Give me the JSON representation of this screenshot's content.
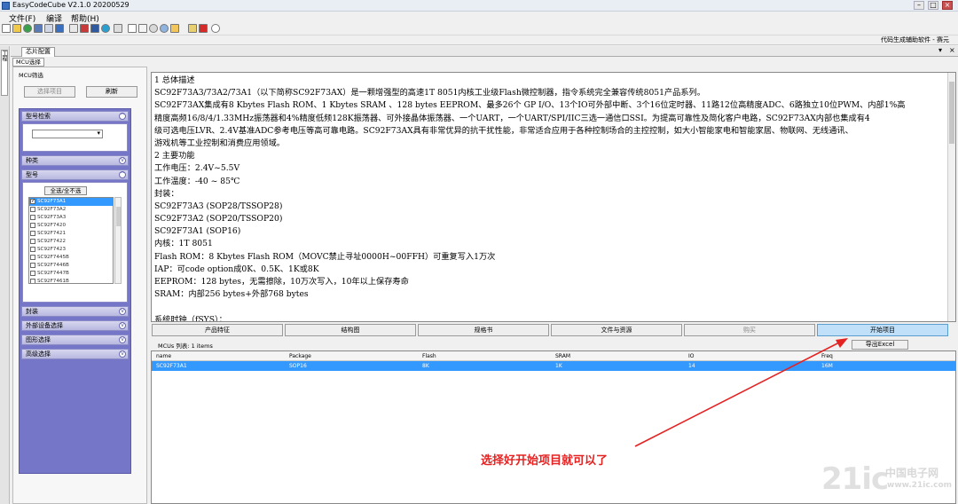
{
  "window": {
    "title": "EasyCodeCube V2.1.0 20200529"
  },
  "menu": [
    "文件(F)",
    "编译",
    "帮助(H)"
  ],
  "toolbar_icons": [
    "new-file-icon",
    "open-folder-icon",
    "refresh-icon",
    "save-icon",
    "bookmark-icon",
    "download-icon",
    "export-icon",
    "pdf-icon",
    "chip-icon",
    "globe-icon",
    "chip-small-icon",
    "print-icon",
    "search-icon",
    "gear-icon",
    "gear-alt-icon",
    "hand-icon",
    "dropdown-icon",
    "lock-icon",
    "logo-red-icon",
    "info-icon"
  ],
  "helper_bar": {
    "text": "代码生成辅助软件 - 赛元"
  },
  "side_rail": {
    "tab": "工程"
  },
  "doc_tab": {
    "label": "芯片配置"
  },
  "mcu_tab": {
    "label": "MCU选择"
  },
  "left_panel": {
    "sub_label": "MCU筛选",
    "select_button": "选择项目",
    "refresh_button": "刷新",
    "sections": {
      "model_search": "型号检索",
      "core": "种类",
      "model": "型号",
      "package": "封装",
      "peripheral": "外部设备选择",
      "graphic": "图形选择",
      "advanced": "高级选择"
    },
    "select_all": "全选/全不选",
    "models": [
      "SC92F73A1",
      "SC92F73A2",
      "SC92F73A3",
      "SC92F7420",
      "SC92F7421",
      "SC92F7422",
      "SC92F7423",
      "SC92F7445B",
      "SC92F7446B",
      "SC92F7447B",
      "SC92F7461B"
    ]
  },
  "description": {
    "lines": [
      "1 总体描述",
      "        SC92F73A3/73A2/73A1（以下简称SC92F73AX）是一颗增强型的高速1T 8051内核工业级Flash微控制器，指令系统完全兼容传统8051产品系列。",
      "SC92F73AX集成有8 Kbytes Flash ROM、1 Kbytes SRAM 、128 bytes EEPROM、最多26个 GP I/O、13个IO可外部中断、3个16位定时器、11路12位高精度ADC、6路独立10位PWM、内部1%高",
      "精度高频16/8/4/1.33MHz振荡器和4%精度低频128K振荡器、可外接晶体振荡器、一个UART，一个UART/SPI/IIC三选一通信口SSI。为提高可靠性及简化客户电路，SC92F73AX内部也集成有4",
      "级可选电压LVR、2.4V基准ADC参考电压等高可靠电路。SC92F73AX具有非常优异的抗干扰性能，非常适合应用于各种控制场合的主控控制，如大小智能家电和智能家居、物联网、无线通讯、",
      "游戏机等工业控制和消费应用领域。",
      "2 主要功能",
      "工作电压：2.4V~5.5V",
      "工作温度：-40 ~ 85℃",
      "封装：",
      "SC92F73A3 (SOP28/TSSOP28)",
      "SC92F73A2 (SOP20/TSSOP20)",
      "SC92F73A1 (SOP16)",
      "内核：1T 8051",
      "Flash ROM：8 Kbytes Flash ROM（MOVC禁止寻址0000H~00FFH）可重复写入1万次",
      "IAP：可code option成0K、0.5K、1K或8K",
      "EEPROM：128 bytes，无需擦除，10万次写入，10年以上保存寿命",
      "SRAM：内部256 bytes+外部768 bytes",
      "",
      "系统时钟（fSYS）："
    ]
  },
  "actions": {
    "features": "产品特征",
    "diagram": "结构图",
    "spec": "规格书",
    "docs": "文件与资源",
    "buy": "购买",
    "start": "开始项目"
  },
  "list": {
    "count_label": "MCUs 列表:  1 items",
    "export": "导出Excel",
    "columns": [
      "name",
      "Package",
      "Flash",
      "SRAM",
      "IO",
      "Freq"
    ],
    "rows": [
      [
        "SC92F73A1",
        "SOP16",
        "8K",
        "1K",
        "14",
        "16M"
      ]
    ]
  },
  "annotation": {
    "text": "选择好开始项目就可以了",
    "color": "#e42222"
  },
  "watermark": {
    "logo": "21ic",
    "site": "中国电子网",
    "url": "www.21ic.com"
  }
}
